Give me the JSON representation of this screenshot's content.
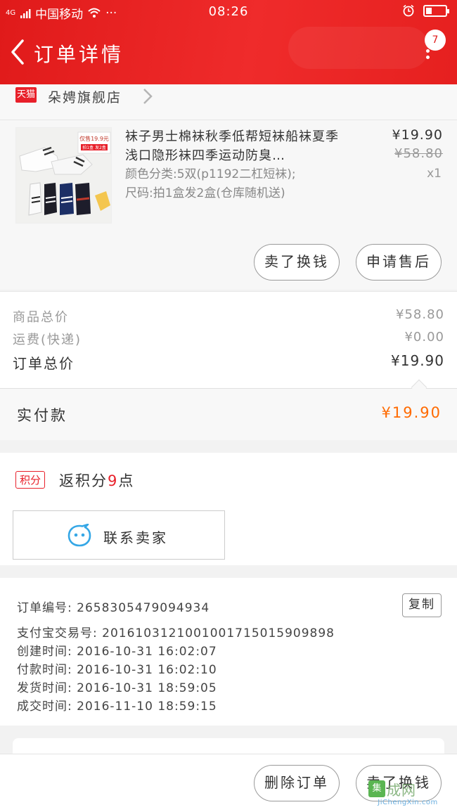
{
  "status_bar": {
    "signal": "4G",
    "carrier": "中国移动",
    "time": "08:26",
    "more": "···"
  },
  "header": {
    "title": "订单详情",
    "badge_count": "7"
  },
  "store": {
    "tmall_label": "天猫",
    "name": "朵娉旗舰店"
  },
  "product": {
    "title": "袜子男士棉袜秋季低帮短袜船袜夏季浅口隐形袜四季运动防臭…",
    "color_spec": "颜色分类:5双(p1192二杠短袜);",
    "size_spec": "尺码:拍1盒发2盒(仓库随机送)",
    "price": "¥19.90",
    "original_price": "¥58.80",
    "quantity": "x1",
    "thumb_badge": "仅售19.9元",
    "thumb_badge_sub": "拍1盒 发2盒",
    "buttons": {
      "resell": "卖了换钱",
      "after_sale": "申请售后"
    }
  },
  "totals": {
    "goods_label": "商品总价",
    "goods_value": "¥58.80",
    "shipping_label": "运费(快递)",
    "shipping_value": "¥0.00",
    "order_label": "订单总价",
    "order_value": "¥19.90",
    "paid_label": "实付款",
    "paid_value": "¥19.90"
  },
  "points": {
    "tag": "积分",
    "prefix": "返积分",
    "count": "9",
    "suffix": "点"
  },
  "contact": {
    "label": "联系卖家"
  },
  "order_info": {
    "order_no": "订单编号: 2658305479094934",
    "alipay_no": "支付宝交易号: 2016103121001001715015909898",
    "created": "创建时间: 2016-10-31 16:02:07",
    "paid": "付款时间: 2016-10-31 16:02:10",
    "shipped": "发货时间: 2016-10-31 18:59:05",
    "completed": "成交时间: 2016-11-10 18:59:15",
    "copy_label": "复制"
  },
  "bottom_bar": {
    "delete_label": "删除订单",
    "resell_label": "卖了换钱"
  },
  "watermark": {
    "logo": "集",
    "text": "成网",
    "site": "JiChengXin.com"
  },
  "colors": {
    "header_red": "#e01a1a",
    "price_orange": "#ff6a00",
    "tmall_red": "#e8202a",
    "contact_blue": "#35a7e6"
  }
}
